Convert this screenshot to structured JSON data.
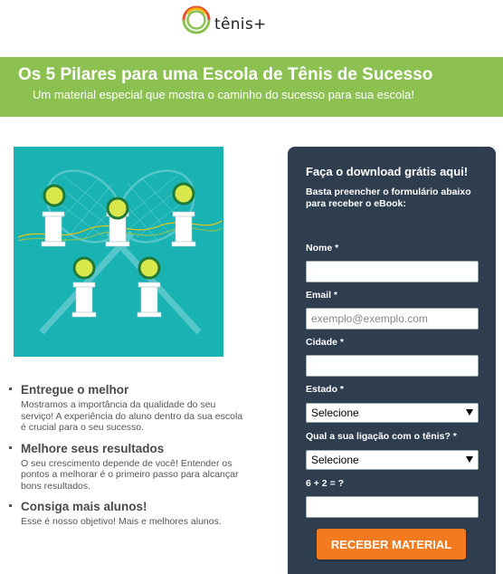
{
  "brand": {
    "name": "tênis+",
    "colors": {
      "green": "#8cc152",
      "orange": "#f47a20",
      "navy": "#2e3e4f",
      "teal": "#1ab3b3"
    }
  },
  "banner": {
    "title": "Os 5 Pilares para uma Escola de Tênis de Sucesso",
    "subtitle": "Um material especial que mostra o caminho do sucesso para sua escola!"
  },
  "illustration": {
    "icon": "crossed-rackets-tennis-balls-pillars"
  },
  "benefits": [
    {
      "title": "Entregue o melhor",
      "text": "Mostramos a importância da qualidade do seu serviço! A experiência do aluno dentro da sua escola é crucial para o seu sucesso."
    },
    {
      "title": "Melhore seus resultados",
      "text": "O seu crescimento depende de você! Entender os pontos a melhorar é o primeiro passo para alcançar bons resultados."
    },
    {
      "title": "Consiga mais alunos!",
      "text": "Esse é nosso objetivo! Mais e melhores alunos."
    }
  ],
  "form": {
    "title": "Faça o download grátis aqui!",
    "description": "Basta preencher o formulário abaixo para receber o eBook:",
    "name_label": "Nome *",
    "name_value": "",
    "email_label": "Email *",
    "email_placeholder": "exemplo@exemplo.com",
    "city_label": "Cidade *",
    "city_value": "",
    "state_label": "Estado *",
    "state_selected": "Selecione",
    "relation_label": "Qual a sua ligação com o tênis? *",
    "relation_selected": "Selecione",
    "captcha_label": "6 + 2 = ?",
    "captcha_value": "",
    "submit_label": "RECEBER MATERIAL"
  }
}
